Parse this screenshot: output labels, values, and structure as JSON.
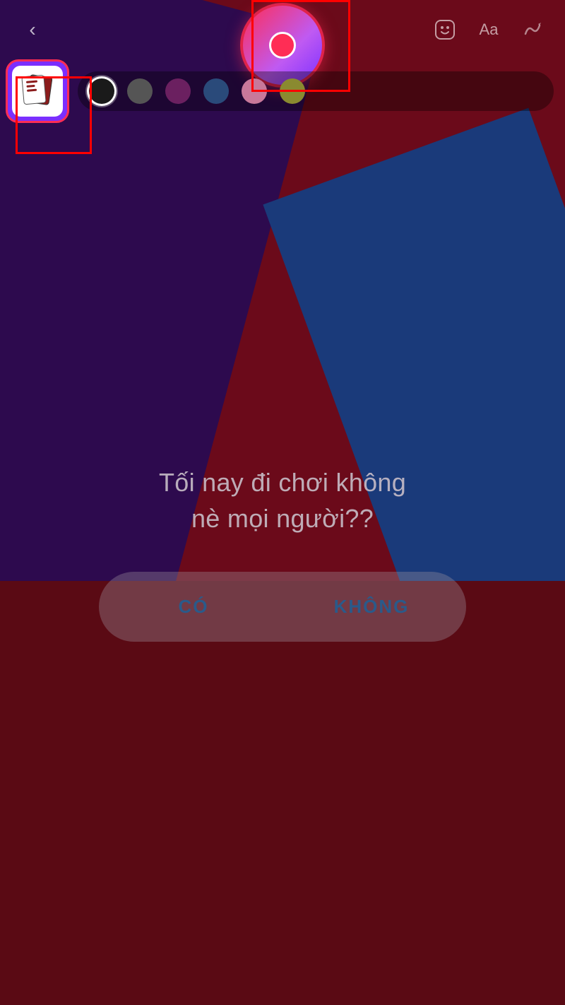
{
  "topBar": {
    "back_label": "‹",
    "font_label": "Aa"
  },
  "palette": {
    "colors": [
      {
        "id": "black",
        "hex": "#1a1a1a",
        "selected": true
      },
      {
        "id": "dark-gray",
        "hex": "#555555"
      },
      {
        "id": "dark-purple",
        "hex": "#6b2060"
      },
      {
        "id": "dark-blue",
        "hex": "#2a4a7a"
      },
      {
        "id": "light-pink",
        "hex": "#c8789a"
      },
      {
        "id": "olive",
        "hex": "#8a8a30"
      }
    ]
  },
  "main": {
    "question": "Tối nay đi chơi không\nnè mọi người??",
    "poll": {
      "option_yes": "CÓ",
      "option_no": "KHÔNG"
    }
  },
  "icons": {
    "back": "‹",
    "sticker": "😀",
    "font": "Aa",
    "squiggle": "∿"
  }
}
